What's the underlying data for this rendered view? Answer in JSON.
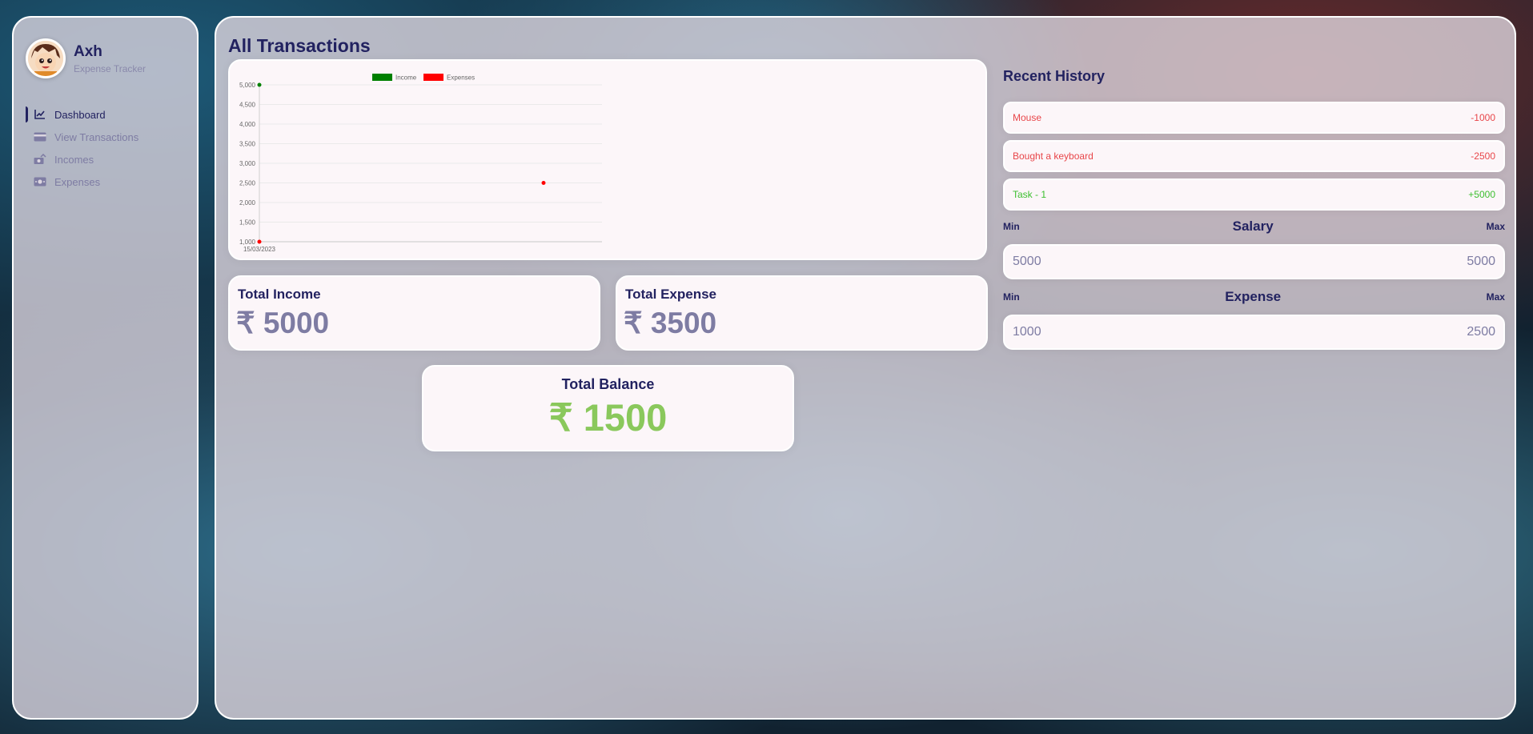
{
  "profile": {
    "name": "Axh",
    "subtitle": "Expense Tracker"
  },
  "nav": {
    "items": [
      {
        "label": "Dashboard",
        "icon": "chart-line-icon",
        "active": true
      },
      {
        "label": "View Transactions",
        "icon": "credit-card-icon",
        "active": false
      },
      {
        "label": "Incomes",
        "icon": "money-bill-trend-up-icon",
        "active": false
      },
      {
        "label": "Expenses",
        "icon": "money-bill-icon",
        "active": false
      }
    ]
  },
  "page": {
    "title": "All Transactions"
  },
  "chart_data": {
    "type": "scatter",
    "categories": [
      "15/03/2023"
    ],
    "ylim": [
      1000,
      5000
    ],
    "yticks": [
      "1,000",
      "1,500",
      "2,000",
      "2,500",
      "3,000",
      "3,500",
      "4,000",
      "4,500",
      "5,000"
    ],
    "legend": "top-center",
    "series": [
      {
        "name": "Income",
        "color": "#008000",
        "points": [
          {
            "x": "15/03/2023",
            "y": 5000
          }
        ]
      },
      {
        "name": "Expenses",
        "color": "#ff0000",
        "points": [
          {
            "x": "15/03/2023",
            "y": 1000
          },
          {
            "x": "",
            "y": 2500
          }
        ]
      }
    ]
  },
  "stats": {
    "income_title": "Total Income",
    "income_value": "₹ 5000",
    "expense_title": "Total Expense",
    "expense_value": "₹ 3500",
    "balance_title": "Total Balance",
    "balance_value": "₹ 1500"
  },
  "history": {
    "title": "Recent History",
    "items": [
      {
        "label": "Mouse",
        "amount": "-1000"
      },
      {
        "label": "Bought a keyboard",
        "amount": "-2500"
      },
      {
        "label": "Task - 1",
        "amount": "+5000"
      }
    ]
  },
  "salary": {
    "title": "Salary",
    "min_label": "Min",
    "max_label": "Max",
    "min_value": "5000",
    "max_value": "5000"
  },
  "expense_range": {
    "title": "Expense",
    "min_label": "Min",
    "max_label": "Max",
    "min_value": "1000",
    "max_value": "2500"
  },
  "colors": {
    "primary": "#222260",
    "muted": "#7e7ca3",
    "positive": "#3cbf2f",
    "negative": "#e8464a",
    "balance": "#8ac85c"
  }
}
